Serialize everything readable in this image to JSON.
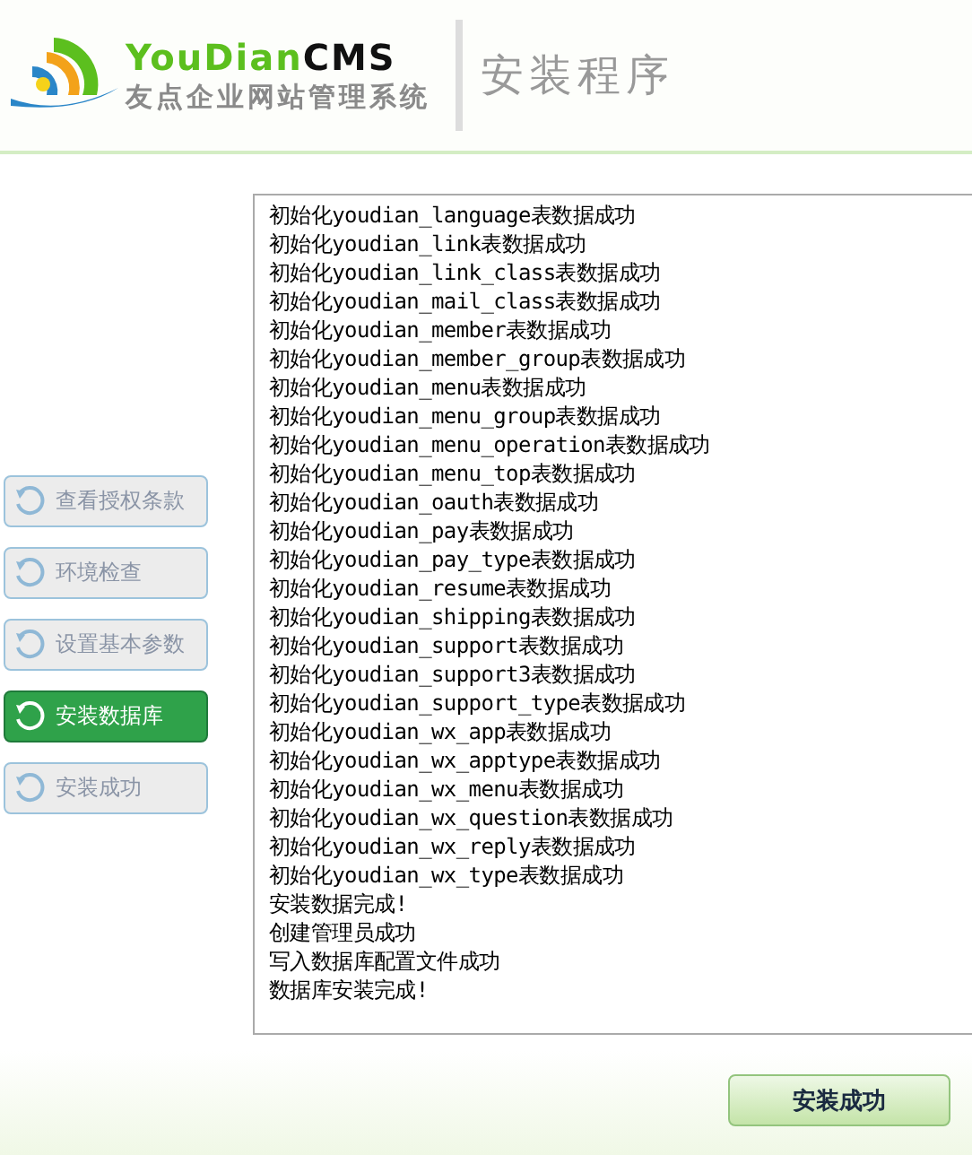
{
  "header": {
    "logo_latin": [
      {
        "text": "YouDian",
        "kind": "green"
      },
      {
        "text": "CMS",
        "kind": "dark"
      }
    ],
    "logo_subtitle": "友点企业网站管理系统",
    "title": "安装程序"
  },
  "steps": [
    {
      "label": "查看授权条款",
      "selected": false
    },
    {
      "label": "环境检查",
      "selected": false
    },
    {
      "label": "设置基本参数",
      "selected": false
    },
    {
      "label": "安装数据库",
      "selected": true
    },
    {
      "label": "安装成功",
      "selected": false
    }
  ],
  "log": [
    "初始化youdian_language表数据成功",
    "初始化youdian_link表数据成功",
    "初始化youdian_link_class表数据成功",
    "初始化youdian_mail_class表数据成功",
    "初始化youdian_member表数据成功",
    "初始化youdian_member_group表数据成功",
    "初始化youdian_menu表数据成功",
    "初始化youdian_menu_group表数据成功",
    "初始化youdian_menu_operation表数据成功",
    "初始化youdian_menu_top表数据成功",
    "初始化youdian_oauth表数据成功",
    "初始化youdian_pay表数据成功",
    "初始化youdian_pay_type表数据成功",
    "初始化youdian_resume表数据成功",
    "初始化youdian_shipping表数据成功",
    "初始化youdian_support表数据成功",
    "初始化youdian_support3表数据成功",
    "初始化youdian_support_type表数据成功",
    "初始化youdian_wx_app表数据成功",
    "初始化youdian_wx_apptype表数据成功",
    "初始化youdian_wx_menu表数据成功",
    "初始化youdian_wx_question表数据成功",
    "初始化youdian_wx_reply表数据成功",
    "初始化youdian_wx_type表数据成功",
    "安装数据完成!",
    "创建管理员成功",
    "写入数据库配置文件成功",
    "数据库安装完成!"
  ],
  "next_button": "安装成功"
}
